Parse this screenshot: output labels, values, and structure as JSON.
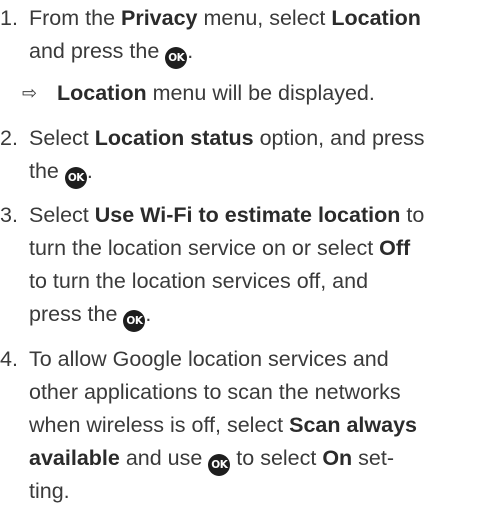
{
  "ok_icon": "OK",
  "result_arrow": "⇨",
  "steps": [
    {
      "num": "1.",
      "l1a": "From the ",
      "l1b": "Privacy",
      "l1c": " menu, select ",
      "l1d": "Location",
      "l2a": "and press the ",
      "l2b": "."
    },
    {
      "num": "2.",
      "l1a": "Select ",
      "l1b": "Location status",
      "l1c": " option, and press",
      "l2a": "the ",
      "l2b": "."
    },
    {
      "num": "3.",
      "l1a": "Select ",
      "l1b": "Use Wi-Fi to estimate location",
      "l1c": " to",
      "l2a": "turn the location service on or select ",
      "l2b": "Off",
      "l3": "to turn the location services off, and",
      "l4a": "press the ",
      "l4b": "."
    },
    {
      "num": "4.",
      "l1": "To allow Google location services and",
      "l2": "other applications to scan the networks",
      "l3a": "when wireless is off, select ",
      "l3b": "Scan always",
      "l4a": "available",
      "l4b": " and use ",
      "l4c": " to select ",
      "l4d": "On",
      "l4e": " set-",
      "l5": "ting."
    }
  ],
  "result": {
    "bold": "Location",
    "rest": " menu will be displayed."
  }
}
